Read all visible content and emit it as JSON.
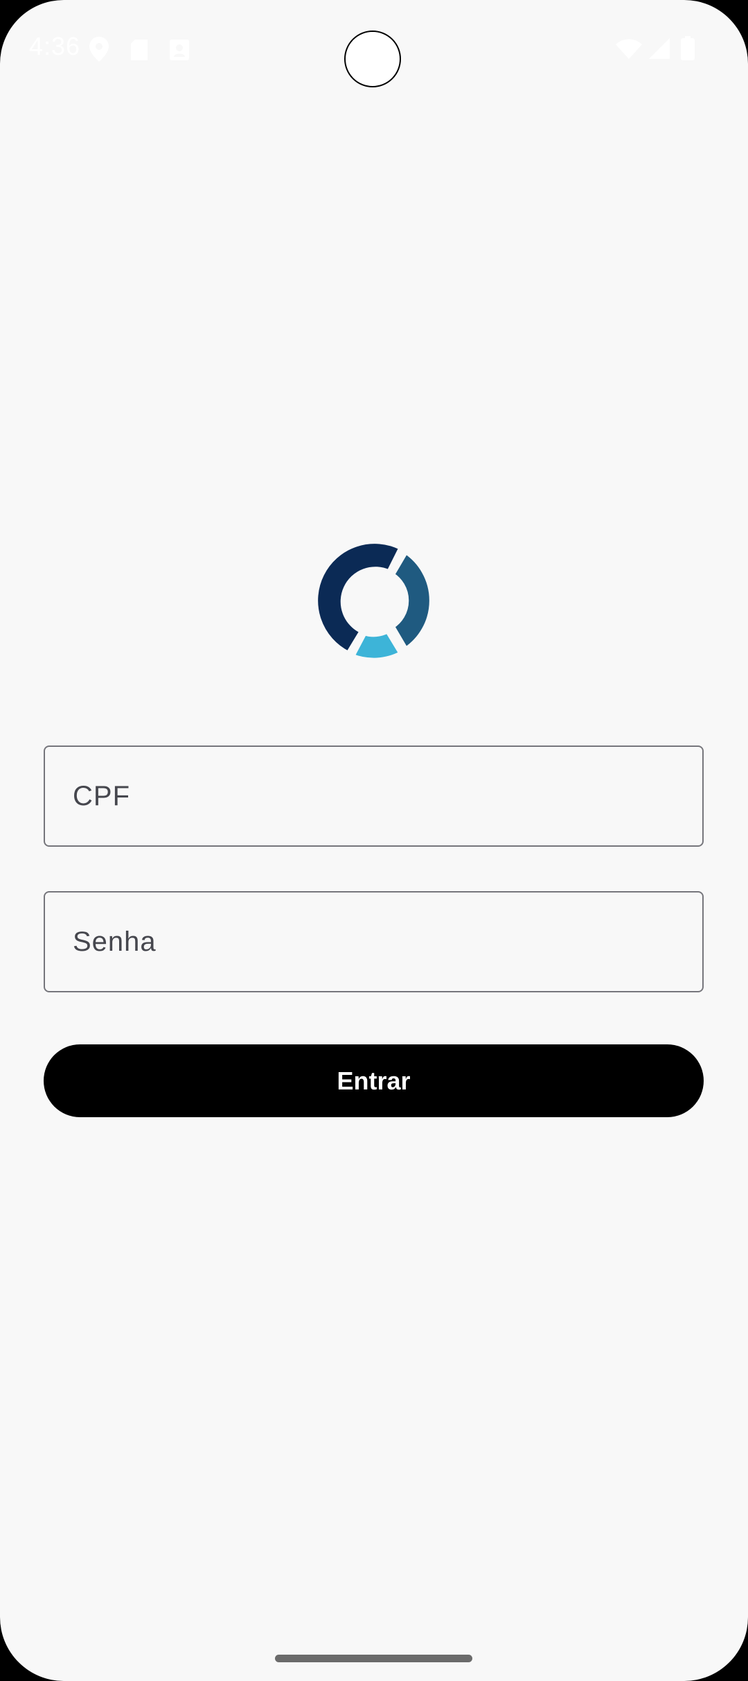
{
  "status_bar": {
    "time": "4:36",
    "icons": [
      "location-icon",
      "sd-card-icon",
      "contact-card-icon",
      "wifi-icon",
      "signal-icon",
      "battery-icon"
    ]
  },
  "login": {
    "logo": "app-logo",
    "cpf_placeholder": "CPF",
    "cpf_value": "",
    "password_placeholder": "Senha",
    "password_value": "",
    "submit_label": "Entrar"
  },
  "colors": {
    "background": "#f8f8f8",
    "button": "#000000",
    "button_text": "#ffffff",
    "field_border": "#76767c",
    "logo_dark_navy": "#0b2a55",
    "logo_steel_blue": "#1f5a80",
    "logo_light_blue": "#3db4d8"
  }
}
